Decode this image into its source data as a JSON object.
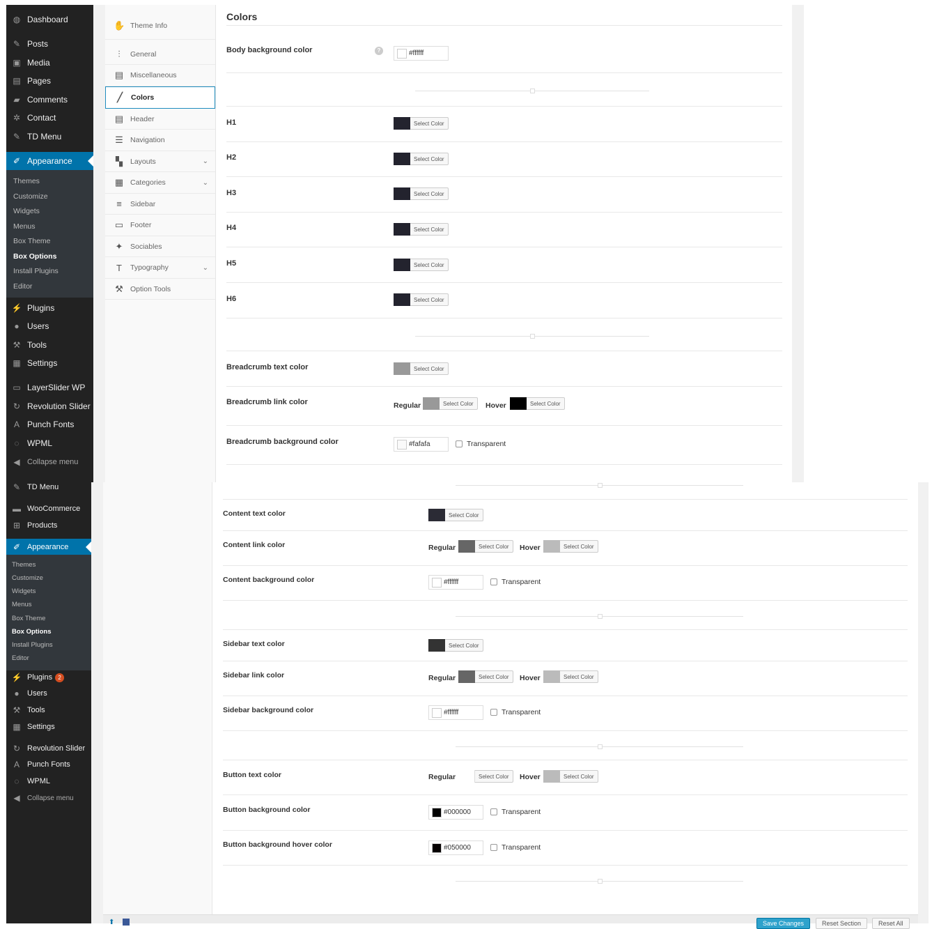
{
  "top": {
    "menu": {
      "dashboard": "Dashboard",
      "posts": "Posts",
      "media": "Media",
      "pages": "Pages",
      "comments": "Comments",
      "contact": "Contact",
      "td_menu": "TD Menu",
      "appearance": "Appearance",
      "sub": [
        "Themes",
        "Customize",
        "Widgets",
        "Menus",
        "Box Theme",
        "Box Options",
        "Install Plugins",
        "Editor"
      ],
      "plugins": "Plugins",
      "users": "Users",
      "tools": "Tools",
      "settings": "Settings",
      "layerslider": "LayerSlider WP",
      "revslider": "Revolution Slider",
      "punchfonts": "Punch Fonts",
      "wpml": "WPML",
      "collapse": "Collapse menu"
    },
    "tabs": [
      "Theme Info",
      "General",
      "Miscellaneous",
      "Colors",
      "Header",
      "Navigation",
      "Layouts",
      "Categories",
      "Sidebar",
      "Footer",
      "Sociables",
      "Typography",
      "Option Tools"
    ],
    "section_title": "Colors",
    "body_bg": {
      "label": "Body background color",
      "value": "#ffffff"
    },
    "headings": [
      "H1",
      "H2",
      "H3",
      "H4",
      "H5",
      "H6"
    ],
    "select_color": "Select Color",
    "breadcrumb_text": "Breadcrumb text color",
    "breadcrumb_link": "Breadcrumb link color",
    "regular": "Regular",
    "hover": "Hover",
    "breadcrumb_bg": {
      "label": "Breadcrumb background color",
      "value": "#fafafa"
    },
    "transparent": "Transparent"
  },
  "bottom": {
    "menu": {
      "td_menu": "TD Menu",
      "woocommerce": "WooCommerce",
      "products": "Products",
      "appearance": "Appearance",
      "sub": [
        "Themes",
        "Customize",
        "Widgets",
        "Menus",
        "Box Theme",
        "Box Options",
        "Install Plugins",
        "Editor"
      ],
      "plugins": "Plugins",
      "plugins_badge": "2",
      "users": "Users",
      "tools": "Tools",
      "settings": "Settings",
      "revslider": "Revolution Slider",
      "punchfonts": "Punch Fonts",
      "wpml": "WPML",
      "collapse": "Collapse menu"
    },
    "content_text": "Content text color",
    "content_link": "Content link color",
    "content_bg": {
      "label": "Content background color",
      "value": "#ffffff"
    },
    "sidebar_text": "Sidebar text color",
    "sidebar_link": "Sidebar link color",
    "sidebar_bg": {
      "label": "Sidebar background color",
      "value": "#ffffff"
    },
    "button_text": "Button text color",
    "button_bg": {
      "label": "Button background color",
      "value": "#000000"
    },
    "button_bg_hover": {
      "label": "Button background hover color",
      "value": "#050000"
    },
    "footer": {
      "save": "Save Changes",
      "reset_section": "Reset Section",
      "reset_all": "Reset All"
    }
  },
  "colors": {
    "admin_bar": "#222222",
    "accent": "#0073aa",
    "heading_swatch": "#23232e",
    "breadcrumb_swatch": "#999999",
    "content_text_swatch": "#2b2b35",
    "link_regular_swatch": "#666666",
    "link_hover_swatch": "#bbbbbb",
    "sidebar_text_swatch": "#333333"
  }
}
